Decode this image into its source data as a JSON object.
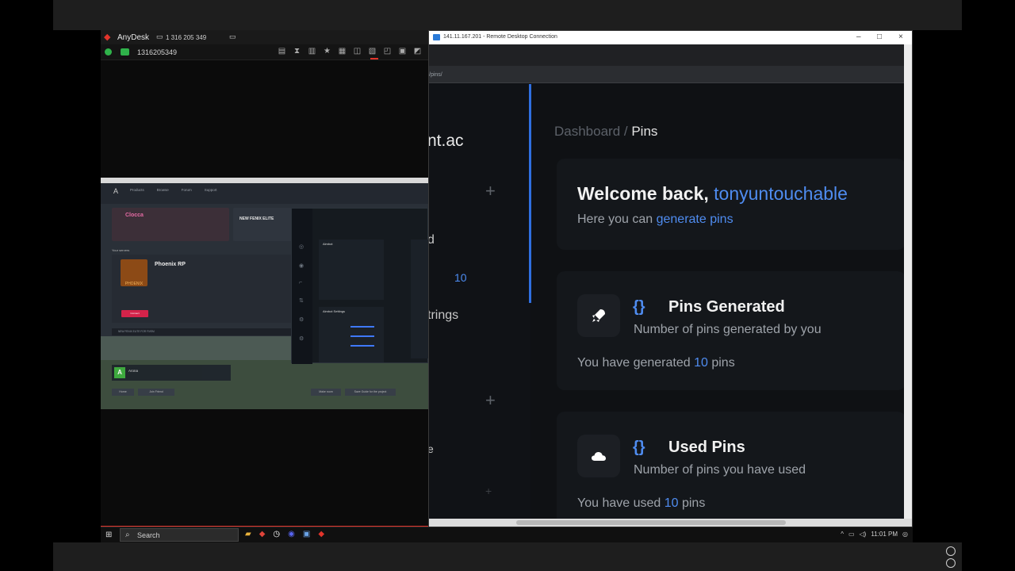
{
  "anydesk": {
    "app_name": "AnyDesk",
    "monitor_label": "1 316 205 349",
    "session_id": "1316205349",
    "thumbnail": {
      "nav_logo": "A",
      "nav_links": [
        "Products",
        "Browse",
        "Forum",
        "Support"
      ],
      "card1_title": "Clocca",
      "card2_title": "NEW FENIX ELITE",
      "your_servers_label": "Your servers",
      "server_name": "Phoenix RP",
      "server_logo_text": "PHOENIX",
      "join_button": "Connect",
      "row_text": "NEW FENIX ELITE FOR FIVEM",
      "profile_initial": "A",
      "profile_name": "Arona",
      "buttons": [
        "Home",
        "Join Friend",
        "Make room",
        "Save Guide for the project"
      ],
      "overlay_panel1": "Aimbot",
      "overlay_panel2": "Aimbot Settings"
    }
  },
  "rdp": {
    "title": "141.11.167.201 - Remote Desktop Connection",
    "url": "/pins/",
    "sidebar": {
      "brand_fragment": "nt.ac",
      "fragment_d": "d",
      "badge": "10",
      "fragment_strings": "trings",
      "fragment_e": "e"
    },
    "breadcrumb": {
      "root": "Dashboard",
      "separator": " / ",
      "current": "Pins"
    },
    "welcome": {
      "greeting": "Welcome back, ",
      "username": "tonyuntouchable",
      "subtitle_prefix": "Here you can ",
      "subtitle_link": "generate pins"
    },
    "stats": [
      {
        "icon": "rocket-icon",
        "braces": "{}",
        "title": "Pins Generated",
        "description": "Number of pins generated by you",
        "line_prefix": "You have generated ",
        "value": "10",
        "line_suffix": " pins"
      },
      {
        "icon": "cloud-icon",
        "braces": "{}",
        "title": "Used Pins",
        "description": "Number of pins you have used",
        "line_prefix": "You have used ",
        "value": "10",
        "line_suffix": " pins"
      }
    ]
  },
  "taskbar": {
    "search_placeholder": "Search",
    "clock": "11:01 PM"
  },
  "colors": {
    "accent": "#4f8cf0",
    "anydesk_red": "#e2342b",
    "ok_green": "#2fb24a"
  }
}
